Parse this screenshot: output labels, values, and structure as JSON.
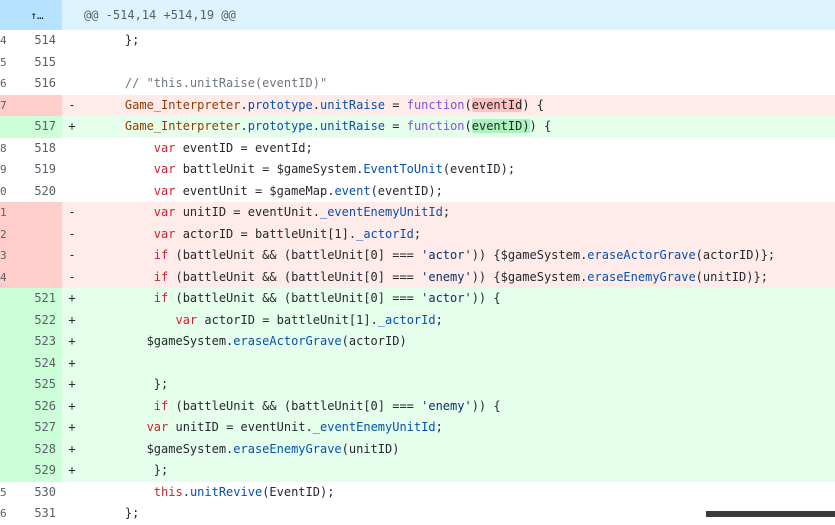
{
  "hunk": {
    "header": "@@ -514,14 +514,19 @@",
    "expand_icon": "expand-up-icon"
  },
  "lines": [
    {
      "type": "ctx",
      "old": "4",
      "new": "514",
      "marker": "",
      "code": "    };"
    },
    {
      "type": "ctx",
      "old": "5",
      "new": "515",
      "marker": "",
      "code": ""
    },
    {
      "type": "ctx",
      "old": "6",
      "new": "516",
      "marker": "",
      "code": "    // \"this.unitRaise(eventID)\""
    },
    {
      "type": "del",
      "old": "7",
      "new": "",
      "marker": "-",
      "code": "    Game_Interpreter.prototype.unitRaise = function(eventId) {"
    },
    {
      "type": "add",
      "old": "",
      "new": "517",
      "marker": "+",
      "code": "    Game_Interpreter.prototype.unitRaise = function(eventID)) {"
    },
    {
      "type": "ctx",
      "old": "8",
      "new": "518",
      "marker": "",
      "code": "        var eventID = eventId;"
    },
    {
      "type": "ctx",
      "old": "9",
      "new": "519",
      "marker": "",
      "code": "        var battleUnit = $gameSystem.EventToUnit(eventID);"
    },
    {
      "type": "ctx",
      "old": "0",
      "new": "520",
      "marker": "",
      "code": "        var eventUnit = $gameMap.event(eventID);"
    },
    {
      "type": "del",
      "old": "1",
      "new": "",
      "marker": "-",
      "code": "        var unitID = eventUnit._eventEnemyUnitId;"
    },
    {
      "type": "del",
      "old": "2",
      "new": "",
      "marker": "-",
      "code": "        var actorID = battleUnit[1]._actorId;"
    },
    {
      "type": "del",
      "old": "3",
      "new": "",
      "marker": "-",
      "code": "        if (battleUnit && (battleUnit[0] === 'actor')) {$gameSystem.eraseActorGrave(actorID)};"
    },
    {
      "type": "del",
      "old": "4",
      "new": "",
      "marker": "-",
      "code": "        if (battleUnit && (battleUnit[0] === 'enemy')) {$gameSystem.eraseEnemyGrave(unitID)};"
    },
    {
      "type": "add",
      "old": "",
      "new": "521",
      "marker": "+",
      "code": "        if (battleUnit && (battleUnit[0] === 'actor')) {"
    },
    {
      "type": "add",
      "old": "",
      "new": "522",
      "marker": "+",
      "code": "           var actorID = battleUnit[1]._actorId;"
    },
    {
      "type": "add",
      "old": "",
      "new": "523",
      "marker": "+",
      "code": "       $gameSystem.eraseActorGrave(actorID)"
    },
    {
      "type": "add",
      "old": "",
      "new": "524",
      "marker": "+",
      "code": ""
    },
    {
      "type": "add",
      "old": "",
      "new": "525",
      "marker": "+",
      "code": "        };"
    },
    {
      "type": "add",
      "old": "",
      "new": "526",
      "marker": "+",
      "code": "        if (battleUnit && (battleUnit[0] === 'enemy')) {"
    },
    {
      "type": "add",
      "old": "",
      "new": "527",
      "marker": "+",
      "code": "       var unitID = eventUnit._eventEnemyUnitId;"
    },
    {
      "type": "add",
      "old": "",
      "new": "528",
      "marker": "+",
      "code": "       $gameSystem.eraseEnemyGrave(unitID)"
    },
    {
      "type": "add",
      "old": "",
      "new": "529",
      "marker": "+",
      "code": "        };"
    },
    {
      "type": "ctx",
      "old": "5",
      "new": "530",
      "marker": "",
      "code": "        this.unitRevive(EventID);"
    },
    {
      "type": "ctx",
      "old": "6",
      "new": "531",
      "marker": "",
      "code": "    };"
    }
  ]
}
